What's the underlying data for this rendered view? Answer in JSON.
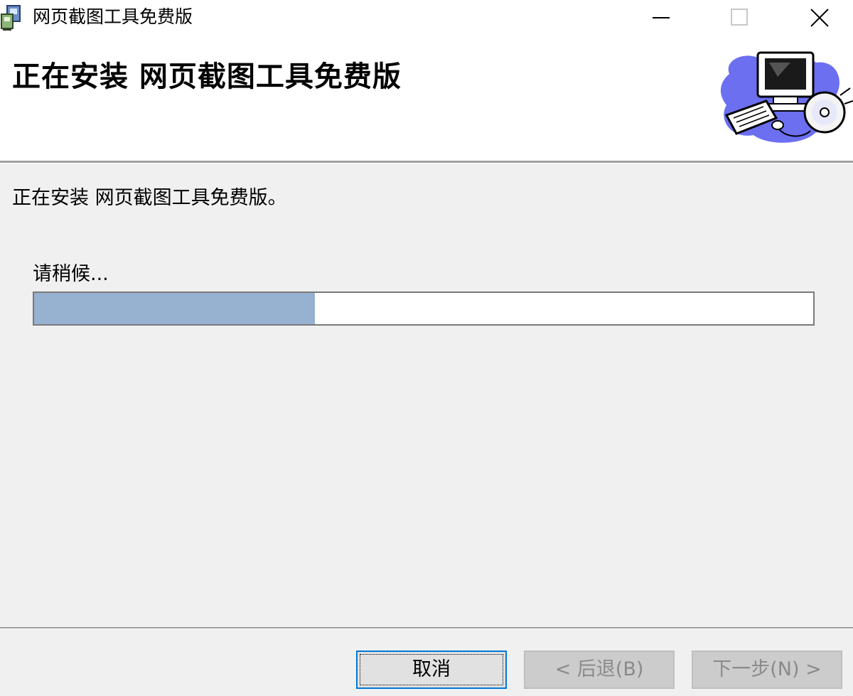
{
  "window": {
    "title": "网页截图工具免费版",
    "controls": {
      "minimize_icon": "minimize-icon",
      "maximize_icon": "maximize-icon",
      "close_icon": "close-icon"
    }
  },
  "banner": {
    "title": "正在安装 网页截图工具免费版",
    "graphic_icon": "computer-cd-icon"
  },
  "content": {
    "status_text": "正在安装 网页截图工具免费版。",
    "wait_label": "请稍候...",
    "progress_fraction": 0.36
  },
  "buttons": {
    "cancel": "取消",
    "back": "< 后退(B)",
    "next": "下一步(N) >"
  },
  "colors": {
    "progress_fill": "#97b1d0",
    "focus_border": "#0078d7",
    "background": "#f0f0f0"
  }
}
